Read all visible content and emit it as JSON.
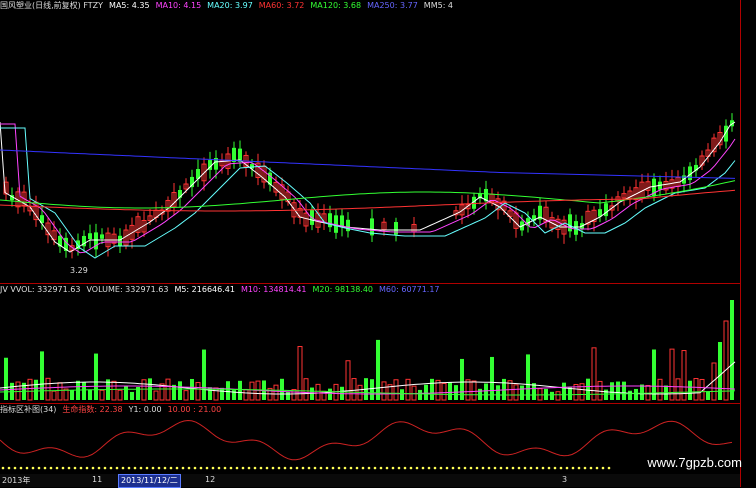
{
  "main_header": {
    "title": "国风塑业(日线,前复权) FTZY",
    "ma5": "MA5: 4.35",
    "ma10": "MA10: 4.15",
    "ma20": "MA20: 3.97",
    "ma60": "MA60: 3.72",
    "ma120": "MA120: 3.68",
    "ma250": "MA250: 3.77",
    "mm5": "MM5: 4"
  },
  "volume_header": {
    "title": "JV VVOL: 332971.63",
    "volume": "VOLUME: 332971.63",
    "m5": "M5: 216646.41",
    "m10": "M10: 134814.41",
    "m20": "M20: 98138.40",
    "m60": "M60: 60771.17"
  },
  "indicator_header": {
    "title": "指标区补图(34)",
    "life": "生命指数: 22.38",
    "y1": "Y1: 0.00",
    "levels": "10.00 : 21.00"
  },
  "low_price_label": "3.29",
  "date_bar": {
    "year": "2013年",
    "selected_date": "2013/11/12/二",
    "ticks": [
      "11",
      "12",
      "3"
    ]
  },
  "watermark": "www.7gpzb.com",
  "colors": {
    "up": "#ff3333",
    "down": "#33ff33",
    "ma5": "#ffffff",
    "ma10": "#ff44ff",
    "ma20": "#66ffff",
    "ma60": "#33ff33",
    "ma120": "#ff3333",
    "ma250": "#3333ff",
    "ind_line": "#cc2222",
    "dots": "#ffff55"
  },
  "chart_data": {
    "type": "candlestick",
    "low_marker": 3.29,
    "candles_y": [],
    "volume_peaks": [],
    "indicator": []
  }
}
